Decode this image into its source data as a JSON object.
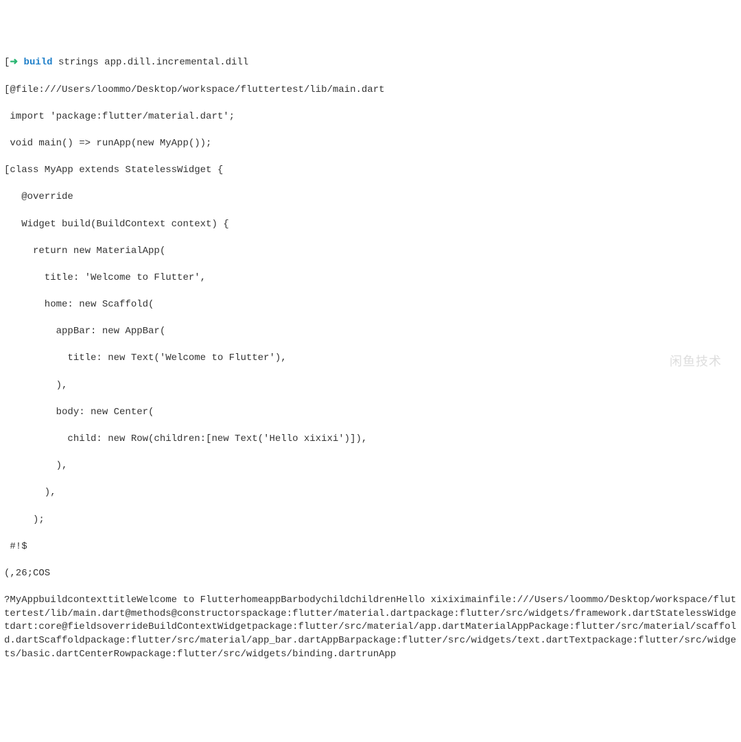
{
  "prompt": {
    "bracket": "[",
    "arrow": "➜ ",
    "command": "build",
    "args": " strings app.dill.incremental.dill"
  },
  "source": {
    "line01": "[@file:///Users/loommo/Desktop/workspace/fluttertest/lib/main.dart",
    "line02": " import 'package:flutter/material.dart';",
    "line03": " void main() => runApp(new MyApp());",
    "line04": "[class MyApp extends StatelessWidget {",
    "line05": "   @override",
    "line06": "   Widget build(BuildContext context) {",
    "line07": "     return new MaterialApp(",
    "line08": "       title: 'Welcome to Flutter',",
    "line09": "       home: new Scaffold(",
    "line10": "         appBar: new AppBar(",
    "line11": "           title: new Text('Welcome to Flutter'),",
    "line12": "         ),",
    "line13": "         body: new Center(",
    "line14": "           child: new Row(children:[new Text('Hello xixixi')]),",
    "line15": "         ),",
    "line16": "       ),",
    "line17": "     );",
    "line18": " #!$",
    "line19": "(,26;COS"
  },
  "footer": "?MyAppbuildcontexttitleWelcome to FlutterhomeappBarbodychildchildrenHello xixiximainfile:///Users/loommo/Desktop/workspace/fluttertest/lib/main.dart@methods@constructorspackage:flutter/material.dartpackage:flutter/src/widgets/framework.dartStatelessWidgetdart:core@fieldsoverrideBuildContextWidgetpackage:flutter/src/material/app.dartMaterialAppPackage:flutter/src/material/scaffold.dartScaffoldpackage:flutter/src/material/app_bar.dartAppBarpackage:flutter/src/widgets/text.dartTextpackage:flutter/src/widgets/basic.dartCenterRowpackage:flutter/src/widgets/binding.dartrunApp",
  "watermark": "闲鱼技术"
}
